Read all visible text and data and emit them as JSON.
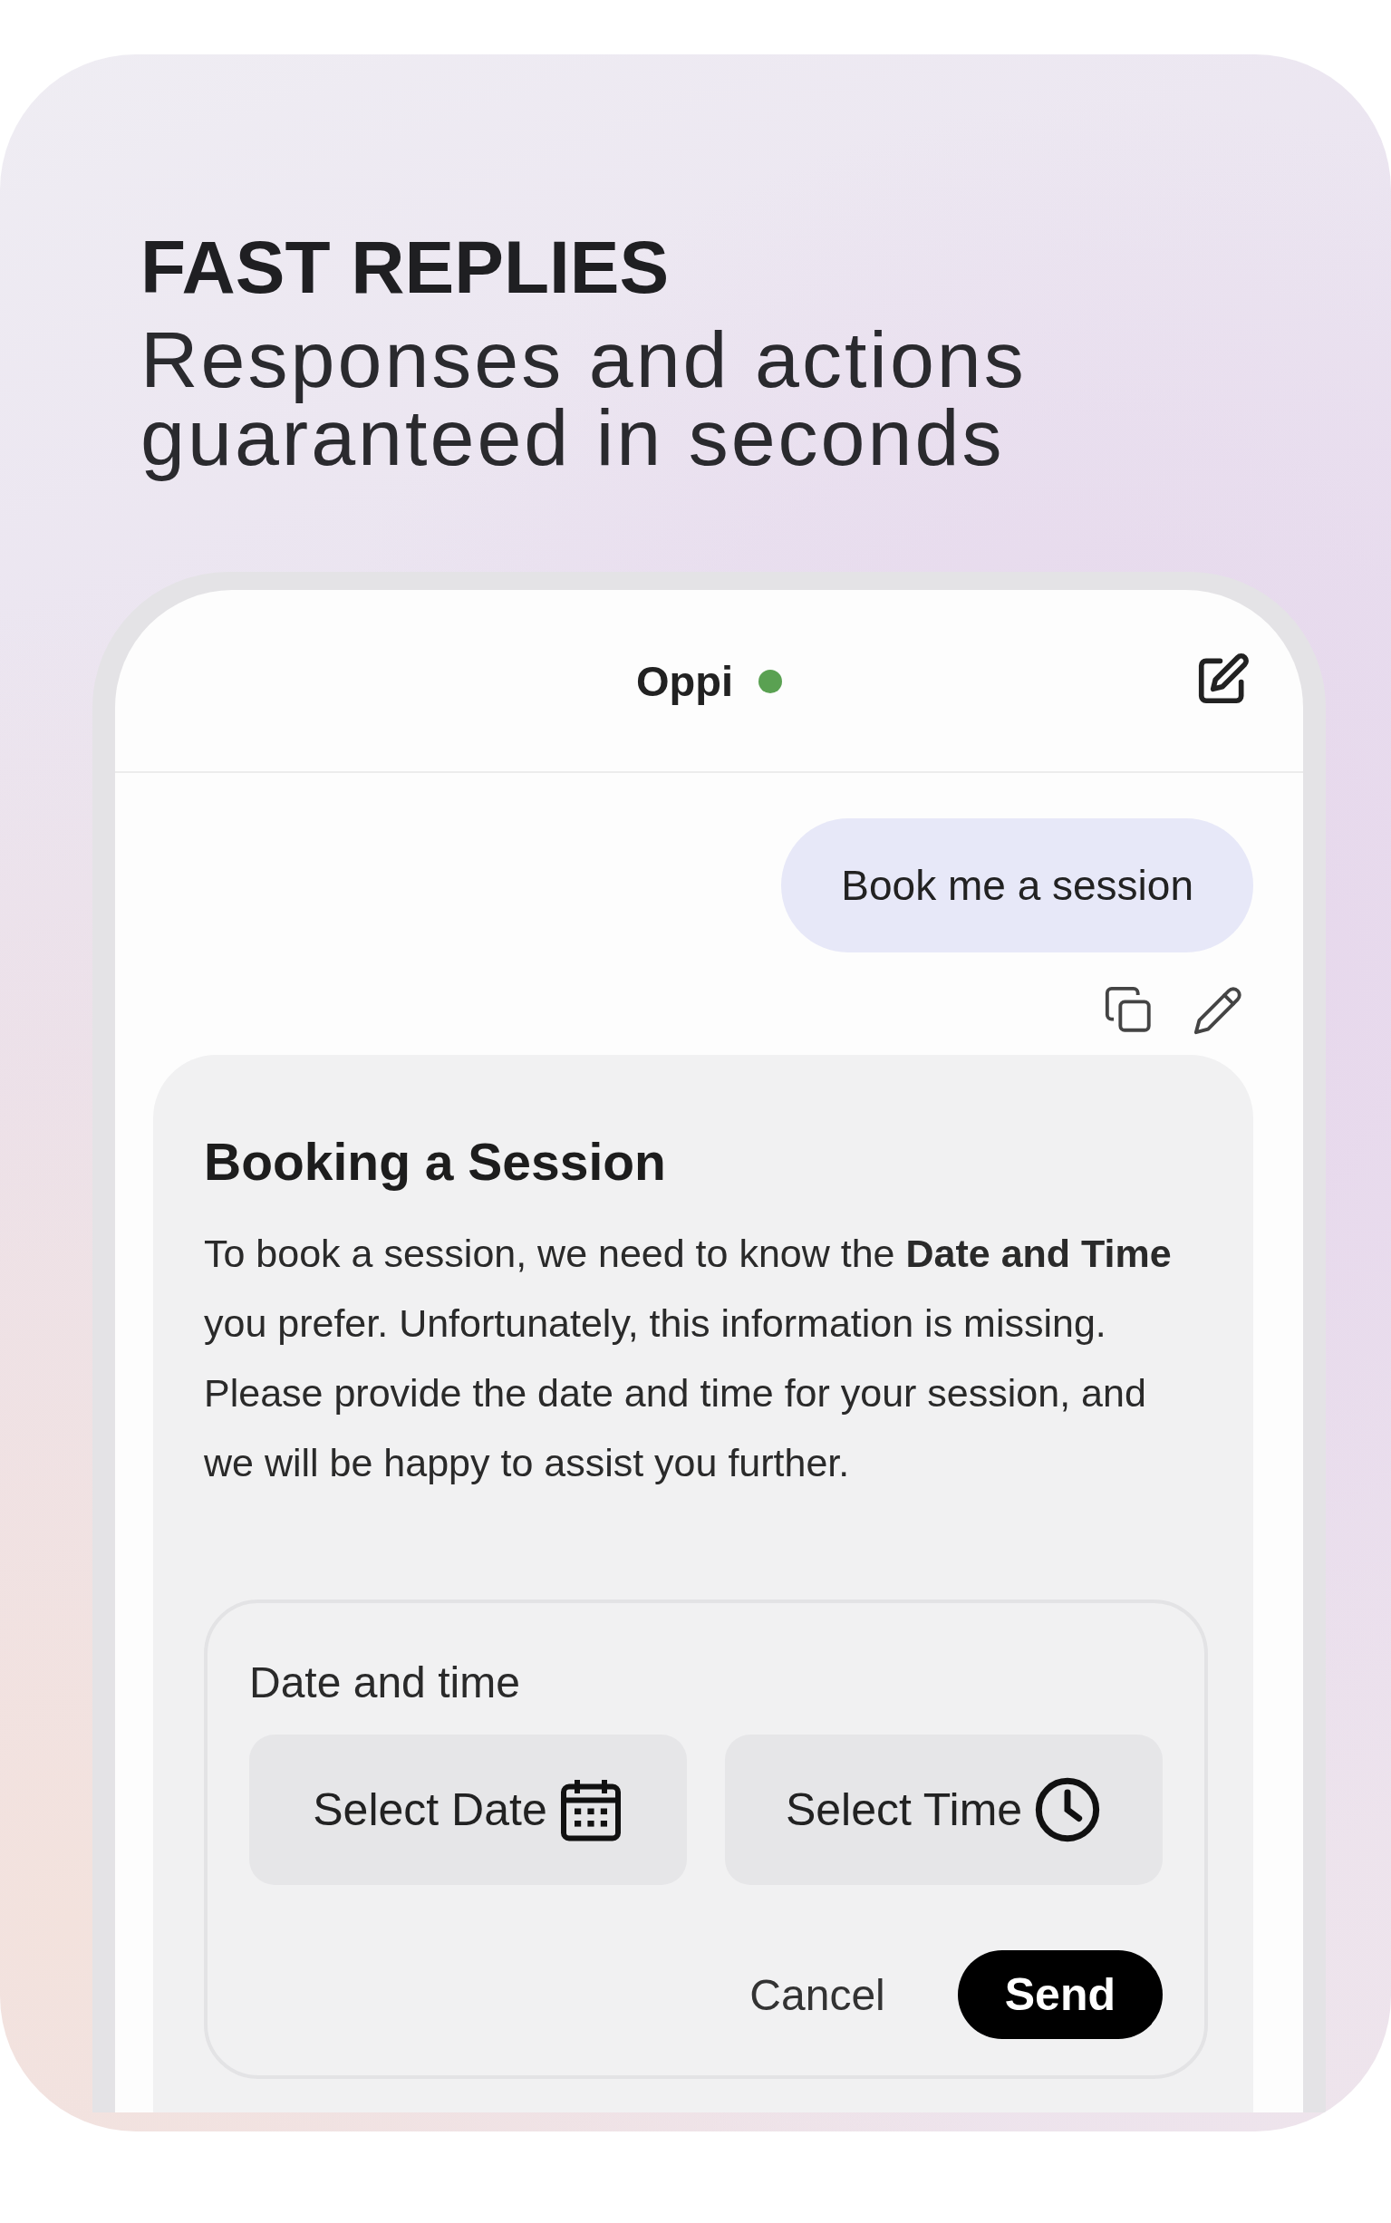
{
  "headline": {
    "title": "FAST REPLIES",
    "subtitle_lines": [
      "Responses and actions",
      "guaranteed in seconds"
    ]
  },
  "chat": {
    "header": {
      "name": "Oppi",
      "online": true
    },
    "user_message": {
      "text": "Book me a session"
    },
    "reply": {
      "title": "Booking a Session",
      "text": "To book a session, we need to know the **Date and Time** you prefer. Unfortunately, this information is missing. Please provide the date and time for your session, and we will be happy to assist you further.",
      "form": {
        "label": "Date and time",
        "pickers": [
          {
            "kind": "date",
            "label": "Select Date"
          },
          {
            "kind": "time",
            "label": "Select Time"
          }
        ],
        "cancel": "Cancel",
        "send": "Send"
      }
    }
  }
}
